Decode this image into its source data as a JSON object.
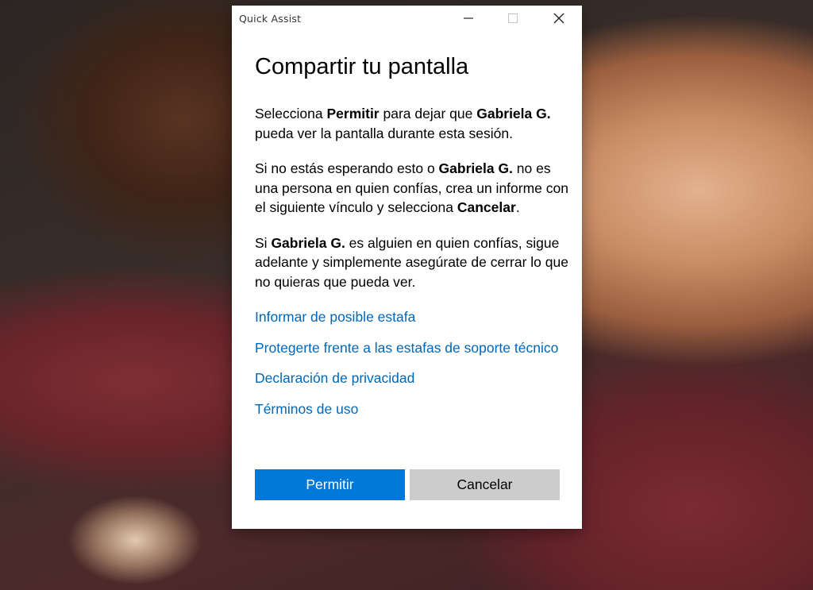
{
  "window": {
    "title": "Quick Assist",
    "controls": {
      "minimize_icon": "minimize-icon",
      "maximize_icon": "maximize-icon",
      "close_icon": "close-icon"
    }
  },
  "dialog": {
    "heading": "Compartir tu pantalla",
    "p1": {
      "t1": "Selecciona ",
      "b1": "Permitir",
      "t2": " para dejar que ",
      "b2": "Gabriela G.",
      "t3": " pueda ver la pantalla durante esta sesión."
    },
    "p2": {
      "t1": "Si no estás esperando esto o ",
      "b1": "Gabriela G.",
      "t2": " no es una persona en quien confías, crea un informe con el siguiente vínculo y selecciona ",
      "b2": "Cancelar",
      "t3": "."
    },
    "p3": {
      "t1": "Si ",
      "b1": "Gabriela G.",
      "t2": " es alguien en quien confías, sigue adelante y simplemente asegúrate de cerrar lo que no quieras que pueda ver."
    },
    "links": [
      "Informar de posible estafa",
      "Protegerte frente a las estafas de soporte técnico",
      "Declaración de privacidad",
      "Términos de uso"
    ],
    "buttons": {
      "allow": "Permitir",
      "cancel": "Cancelar"
    }
  },
  "colors": {
    "accent": "#0078d7",
    "link": "#0067b8",
    "secondary_button": "#cccccc"
  }
}
